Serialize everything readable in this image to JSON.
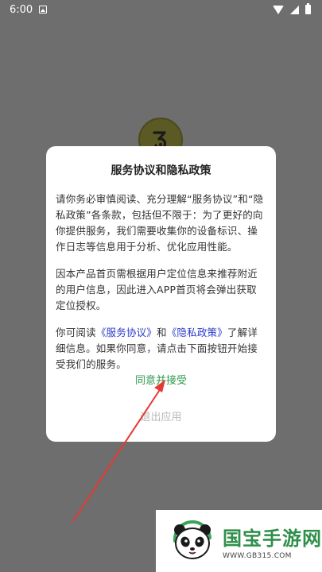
{
  "status_bar": {
    "time": "6:00"
  },
  "dialog": {
    "title": "服务协议和隐私政策",
    "para1": "请你务必审慎阅读、充分理解“服务协议”和“隐私政策”各条款，包括但不限于：为了更好的向你提供服务，我们需要收集你的设备标识、操作日志等信息用于分析、优化应用性能。",
    "para2": "因本产品首页需根据用户定位信息来推荐附近的用户信息，因此进入APP首页将会弹出获取定位授权。",
    "para3_prefix": "你可阅读",
    "service_link": "《服务协议》",
    "para3_and": "和",
    "privacy_link": "《隐私政策》",
    "para3_suffix": "了解详细信息。如果你同意，请点击下面按钮开始接受我们的服务。",
    "accept_label": "同意并接受",
    "exit_label": "退出应用"
  },
  "watermark": {
    "title": "国宝手游网",
    "url": "WWW.GB315.COM"
  },
  "colors": {
    "backdrop": "#6e6e6e",
    "accept": "#2f9a4e",
    "exit": "#b8b8b8",
    "link": "#2b3bc8",
    "arrow": "#e53935"
  },
  "icons": {
    "wifi": "wifi-icon",
    "signal": "signal-icon",
    "battery": "battery-icon",
    "notification": "notification-icon",
    "app_logo": "app-logo-icon",
    "arrow": "red-arrow-annotation"
  }
}
